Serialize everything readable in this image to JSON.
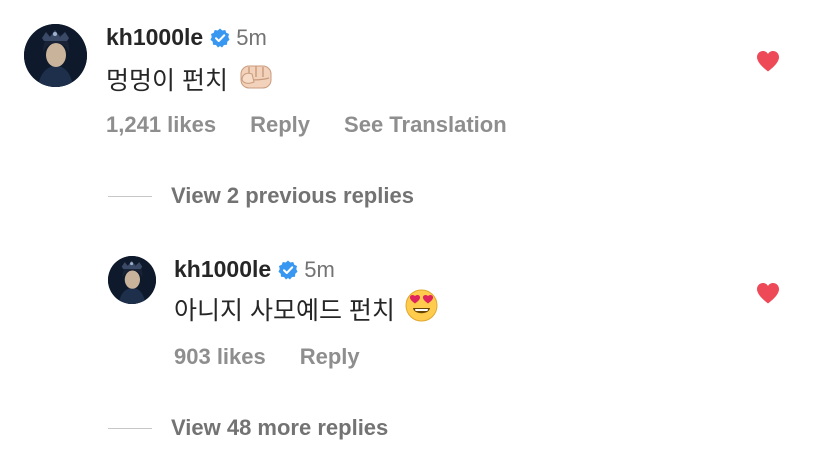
{
  "colors": {
    "heart": "#ed4956",
    "verified": "#3897f0",
    "text_primary": "#262626",
    "text_secondary": "#8e8e8e"
  },
  "comments": [
    {
      "username": "kh1000le",
      "verified": true,
      "time": "5m",
      "text": "멍멍이 펀치",
      "emoji": "👊🏻",
      "likes": "1,241 likes",
      "reply_label": "Reply",
      "translation_label": "See Translation",
      "liked": true
    },
    {
      "username": "kh1000le",
      "verified": true,
      "time": "5m",
      "text": "아니지 사모예드 펀치",
      "emoji": "😍",
      "likes": "903 likes",
      "reply_label": "Reply",
      "liked": true
    }
  ],
  "view_previous": "View 2 previous replies",
  "view_more": "View 48 more replies"
}
